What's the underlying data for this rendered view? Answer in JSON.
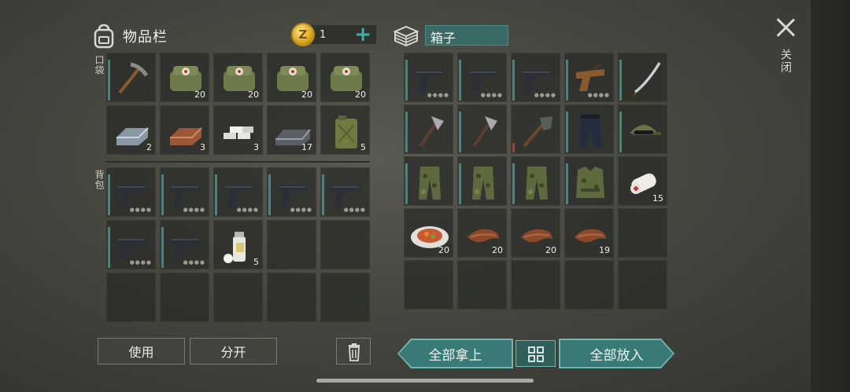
{
  "inventory": {
    "title": "物品栏",
    "pocket_label": "口袋",
    "backpack_label": "背包",
    "coins": "1",
    "pocket_slots": [
      {
        "item": "pickaxe",
        "count": ""
      },
      {
        "item": "medical-bag",
        "count": "20"
      },
      {
        "item": "medical-bag",
        "count": "20"
      },
      {
        "item": "medical-bag",
        "count": "20"
      },
      {
        "item": "medical-bag",
        "count": "20"
      },
      {
        "item": "iron-ingot",
        "count": "2"
      },
      {
        "item": "copper-ingot",
        "count": "3"
      },
      {
        "item": "silver-bars",
        "count": "3"
      },
      {
        "item": "steel-ingot",
        "count": "17"
      },
      {
        "item": "jerrycan",
        "count": "5"
      }
    ],
    "backpack_slots": [
      {
        "item": "pistol",
        "count": ""
      },
      {
        "item": "pistol",
        "count": ""
      },
      {
        "item": "pistol",
        "count": ""
      },
      {
        "item": "pistol",
        "count": ""
      },
      {
        "item": "pistol",
        "count": ""
      },
      {
        "item": "pistol",
        "count": ""
      },
      {
        "item": "pistol",
        "count": ""
      },
      {
        "item": "spray-can",
        "count": "5"
      }
    ]
  },
  "box": {
    "title": "箱子",
    "slots": [
      {
        "item": "pistol",
        "count": ""
      },
      {
        "item": "pistol",
        "count": ""
      },
      {
        "item": "pistol",
        "count": ""
      },
      {
        "item": "flare-gun",
        "count": ""
      },
      {
        "item": "katana",
        "count": ""
      },
      {
        "item": "hatchet",
        "count": ""
      },
      {
        "item": "hatchet",
        "count": ""
      },
      {
        "item": "shovel",
        "count": ""
      },
      {
        "item": "tactical-pants",
        "count": ""
      },
      {
        "item": "military-cap",
        "count": ""
      },
      {
        "item": "camo-pants",
        "count": ""
      },
      {
        "item": "camo-pants",
        "count": ""
      },
      {
        "item": "camo-pants",
        "count": ""
      },
      {
        "item": "camo-vest",
        "count": ""
      },
      {
        "item": "bandages",
        "count": "15"
      },
      {
        "item": "food-plate",
        "count": "20"
      },
      {
        "item": "leather",
        "count": "20"
      },
      {
        "item": "leather",
        "count": "20"
      },
      {
        "item": "leather",
        "count": "19"
      }
    ]
  },
  "buttons": {
    "use": "使用",
    "split": "分开",
    "take_all": "全部拿上",
    "put_all": "全部放入"
  },
  "close_label": "关闭",
  "colors": {
    "accent": "#3a7a76",
    "highlight": "#3b8a8a",
    "coin": "#d9a520"
  }
}
